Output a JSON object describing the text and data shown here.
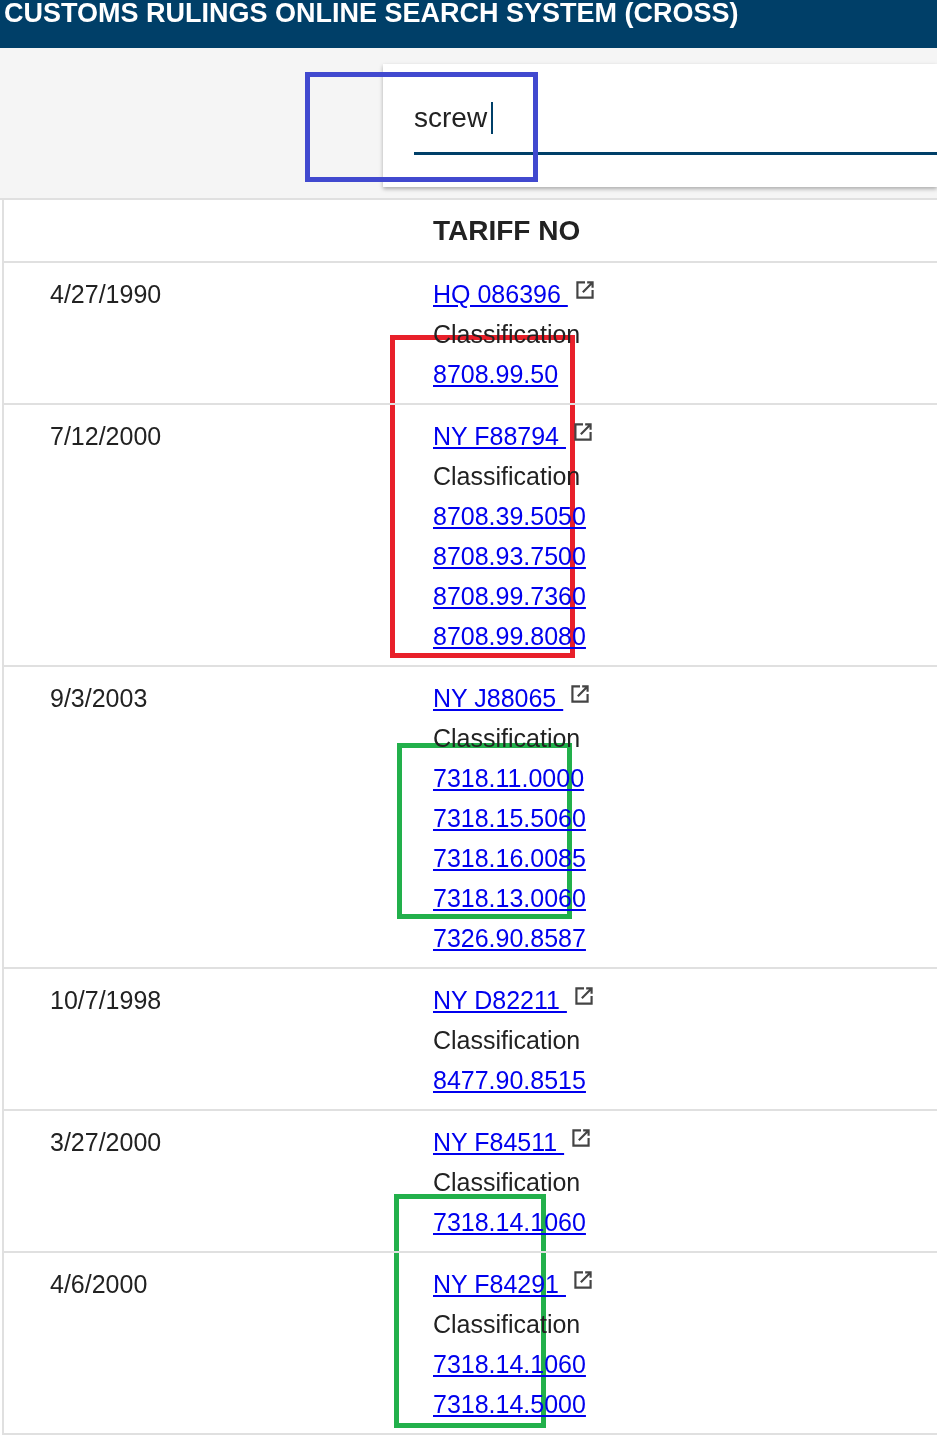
{
  "header": {
    "title": "CUSTOMS RULINGS ONLINE SEARCH SYSTEM (CROSS)"
  },
  "search": {
    "value": "screw"
  },
  "table": {
    "columns": [
      "TARIFF NO"
    ],
    "rows": [
      {
        "date": "4/27/1990",
        "ruling": "HQ 086396",
        "label": "Classification",
        "tariffs": [
          "8708.99.50"
        ]
      },
      {
        "date": "7/12/2000",
        "ruling": "NY F88794",
        "label": "Classification",
        "tariffs": [
          "8708.39.5050",
          "8708.93.7500",
          "8708.99.7360",
          "8708.99.8080"
        ]
      },
      {
        "date": "9/3/2003",
        "ruling": "NY J88065",
        "label": "Classification",
        "tariffs": [
          "7318.11.0000",
          "7318.15.5060",
          "7318.16.0085",
          "7318.13.0060",
          "7326.90.8587"
        ]
      },
      {
        "date": "10/7/1998",
        "ruling": "NY D82211",
        "label": "Classification",
        "tariffs": [
          "8477.90.8515"
        ]
      },
      {
        "date": "3/27/2000",
        "ruling": "NY F84511",
        "label": "Classification",
        "tariffs": [
          "7318.14.1060"
        ]
      },
      {
        "date": "4/6/2000",
        "ruling": "NY F84291",
        "label": "Classification",
        "tariffs": [
          "7318.14.1060",
          "7318.14.5000"
        ]
      }
    ]
  },
  "highlights": [
    {
      "color": "#4149cf"
    },
    {
      "color": "#e8202a"
    },
    {
      "color": "#22b04b"
    },
    {
      "color": "#22b04b"
    }
  ]
}
